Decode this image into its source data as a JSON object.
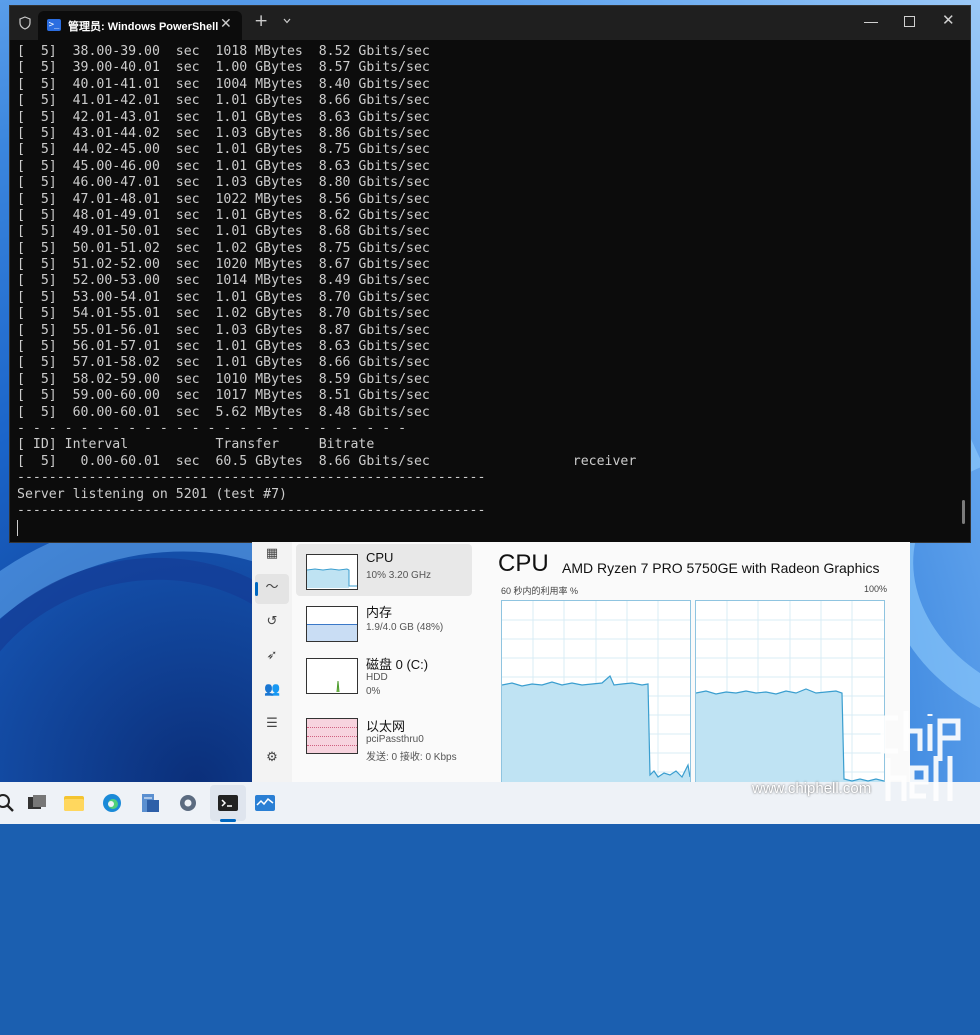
{
  "terminal": {
    "tab_title": "管理员: Windows PowerShell",
    "prompt_icon": "powershell-icon",
    "lines": [
      "[  5]  38.00-39.00  sec  1018 MBytes  8.52 Gbits/sec",
      "[  5]  39.00-40.01  sec  1.00 GBytes  8.57 Gbits/sec",
      "[  5]  40.01-41.01  sec  1004 MBytes  8.40 Gbits/sec",
      "[  5]  41.01-42.01  sec  1.01 GBytes  8.66 Gbits/sec",
      "[  5]  42.01-43.01  sec  1.01 GBytes  8.63 Gbits/sec",
      "[  5]  43.01-44.02  sec  1.03 GBytes  8.86 Gbits/sec",
      "[  5]  44.02-45.00  sec  1.01 GBytes  8.75 Gbits/sec",
      "[  5]  45.00-46.00  sec  1.01 GBytes  8.63 Gbits/sec",
      "[  5]  46.00-47.01  sec  1.03 GBytes  8.80 Gbits/sec",
      "[  5]  47.01-48.01  sec  1022 MBytes  8.56 Gbits/sec",
      "[  5]  48.01-49.01  sec  1.01 GBytes  8.62 Gbits/sec",
      "[  5]  49.01-50.01  sec  1.01 GBytes  8.68 Gbits/sec",
      "[  5]  50.01-51.02  sec  1.02 GBytes  8.75 Gbits/sec",
      "[  5]  51.02-52.00  sec  1020 MBytes  8.67 Gbits/sec",
      "[  5]  52.00-53.00  sec  1014 MBytes  8.49 Gbits/sec",
      "[  5]  53.00-54.01  sec  1.01 GBytes  8.70 Gbits/sec",
      "[  5]  54.01-55.01  sec  1.02 GBytes  8.70 Gbits/sec",
      "[  5]  55.01-56.01  sec  1.03 GBytes  8.87 Gbits/sec",
      "[  5]  56.01-57.01  sec  1.01 GBytes  8.63 Gbits/sec",
      "[  5]  57.01-58.02  sec  1.01 GBytes  8.66 Gbits/sec",
      "[  5]  58.02-59.00  sec  1010 MBytes  8.59 Gbits/sec",
      "[  5]  59.00-60.00  sec  1017 MBytes  8.51 Gbits/sec",
      "[  5]  60.00-60.01  sec  5.62 MBytes  8.48 Gbits/sec",
      "- - - - - - - - - - - - - - - - - - - - - - - - -",
      "[ ID] Interval           Transfer     Bitrate",
      "[  5]   0.00-60.01  sec  60.5 GBytes  8.66 Gbits/sec                  receiver",
      "-----------------------------------------------------------",
      "Server listening on 5201 (test #7)",
      "-----------------------------------------------------------"
    ]
  },
  "taskmgr": {
    "resources": [
      {
        "name": "CPU",
        "sub1": "10% 3.20 GHz",
        "sub2": ""
      },
      {
        "name": "内存",
        "sub1": "1.9/4.0 GB (48%)",
        "sub2": ""
      },
      {
        "name": "磁盘 0 (C:)",
        "sub1": "HDD",
        "sub2": "0%"
      },
      {
        "name": "以太网",
        "sub1": "pciPassthru0",
        "sub2": "发送: 0 接收: 0 Kbps"
      }
    ],
    "main_title": "CPU",
    "cpu_model": "AMD Ryzen 7 PRO 5750GE with Radeon Graphics",
    "graph_left_label": "60 秒内的利用率 %",
    "graph_right_label": "100%"
  },
  "watermark": {
    "url": "www.chiphell.com",
    "logo_text": "chip hell"
  },
  "colors": {
    "terminal_bg": "#0c0c0c",
    "terminal_text": "#cccccc",
    "cpu_fill": "#bfe3f3",
    "cpu_line": "#3a9ecf",
    "memory_fill": "#c9ddf4",
    "network_fill": "#f2b6c8",
    "accent": "#0067c0"
  }
}
